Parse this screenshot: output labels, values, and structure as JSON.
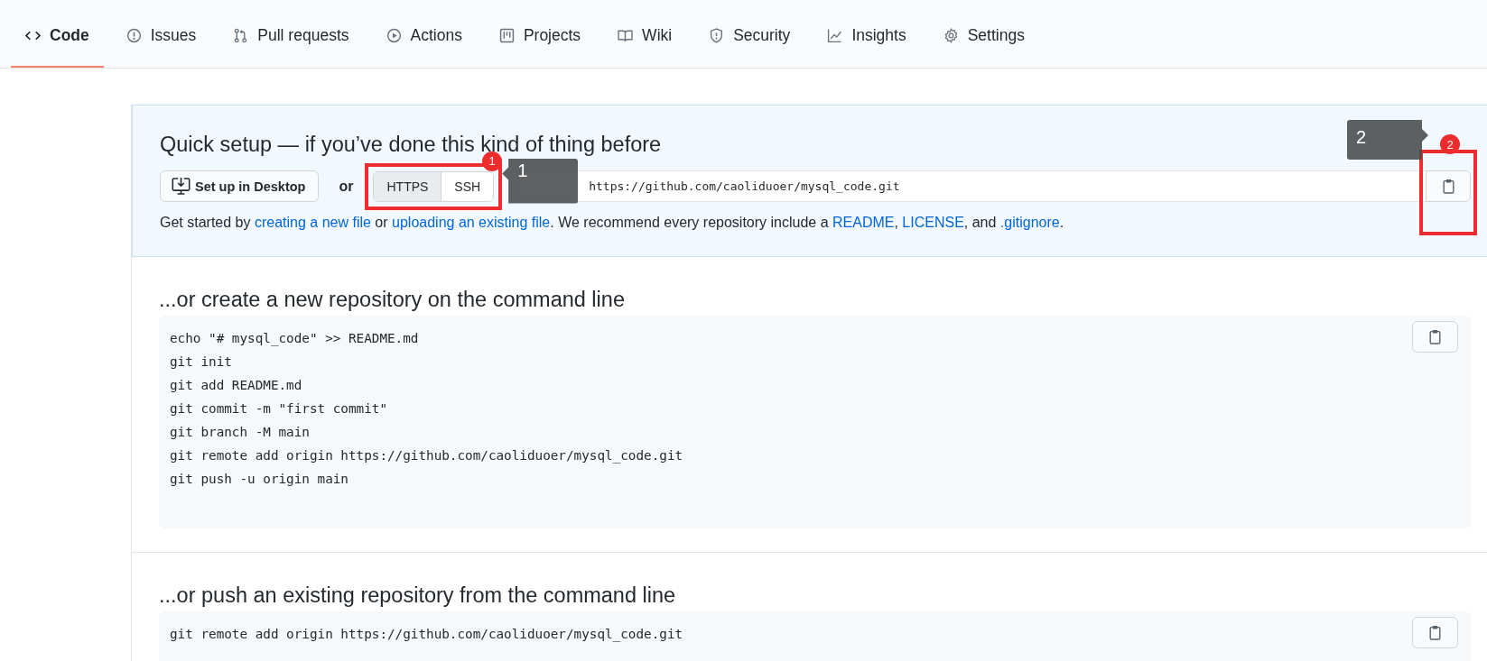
{
  "tabs": [
    {
      "label": "Code",
      "selected": true
    },
    {
      "label": "Issues",
      "selected": false
    },
    {
      "label": "Pull requests",
      "selected": false
    },
    {
      "label": "Actions",
      "selected": false
    },
    {
      "label": "Projects",
      "selected": false
    },
    {
      "label": "Wiki",
      "selected": false
    },
    {
      "label": "Security",
      "selected": false
    },
    {
      "label": "Insights",
      "selected": false
    },
    {
      "label": "Settings",
      "selected": false
    }
  ],
  "quick_setup": {
    "title": "Quick setup — if you’ve done this kind of thing before",
    "desktop_button": "Set up in Desktop",
    "or": "or",
    "protocols": [
      {
        "label": "HTTPS",
        "selected": true
      },
      {
        "label": "SSH",
        "selected": false
      }
    ],
    "clone_url": "https://github.com/caoliduoer/mysql_code.git",
    "hint": [
      {
        "text": "Get started by ",
        "kind": "text"
      },
      {
        "text": "creating a new file",
        "kind": "link"
      },
      {
        "text": " or ",
        "kind": "text"
      },
      {
        "text": "uploading an existing file",
        "kind": "link"
      },
      {
        "text": ". We recommend every repository include a ",
        "kind": "text"
      },
      {
        "text": "README",
        "kind": "link"
      },
      {
        "text": ", ",
        "kind": "text"
      },
      {
        "text": "LICENSE",
        "kind": "link"
      },
      {
        "text": ", and ",
        "kind": "text"
      },
      {
        "text": ".gitignore",
        "kind": "link"
      },
      {
        "text": ".",
        "kind": "text"
      }
    ]
  },
  "sections": [
    {
      "title": "...or create a new repository on the command line",
      "lines": [
        "echo \"# mysql_code\" >> README.md",
        "git init",
        "git add README.md",
        "git commit -m \"first commit\"",
        "git branch -M main",
        "git remote add origin https://github.com/caoliduoer/mysql_code.git",
        "git push -u origin main"
      ]
    },
    {
      "title": "...or push an existing repository from the command line",
      "lines": [
        "git remote add origin https://github.com/caoliduoer/mysql_code.git"
      ]
    }
  ],
  "annotations": [
    {
      "badge": "1",
      "tooltip": "1"
    },
    {
      "badge": "2",
      "tooltip": "2"
    }
  ]
}
